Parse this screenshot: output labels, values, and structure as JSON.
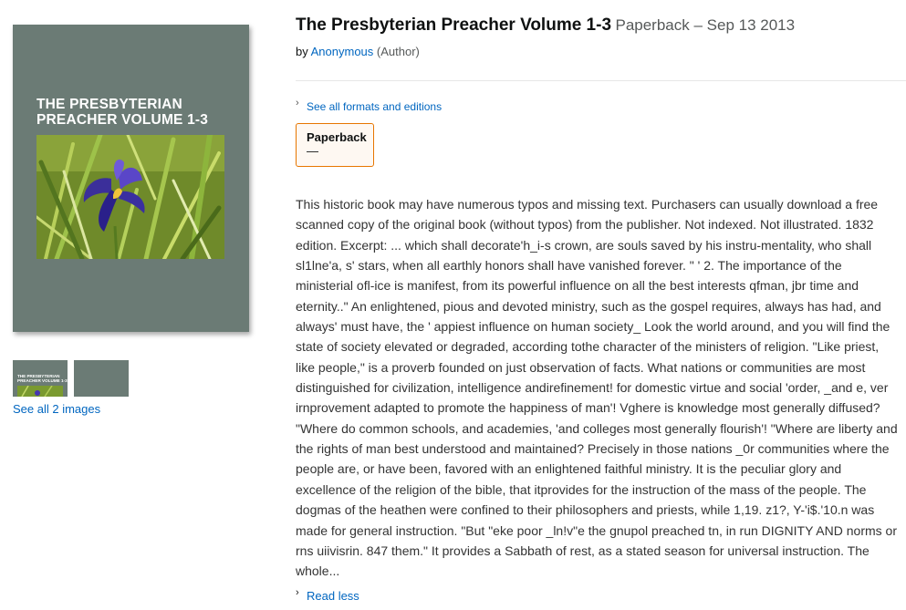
{
  "product": {
    "title": "The Presbyterian Preacher Volume 1-3",
    "format_date": "Paperback – Sep 13 2013",
    "author": "Anonymous",
    "author_role": "(Author)"
  },
  "cover": {
    "title_line1": "THE PRESBYTERIAN",
    "title_line2": "PREACHER VOLUME 1-3",
    "background_color": "#6b7b75"
  },
  "thumbnails": {
    "thumb1_title_line1": "THE PRESBYTERIAN",
    "thumb1_title_line2": "PREACHER VOLUME 1-3",
    "see_all_label": "See all 2 images"
  },
  "formats": {
    "see_all_label": "See all formats and editions",
    "selected_format": "Paperback",
    "selected_price": "—",
    "accent_color": "#e77600"
  },
  "description": {
    "text": "This historic book may have numerous typos and missing text. Purchasers can usually download a free scanned copy of the original book (without typos) from the publisher. Not indexed. Not illustrated. 1832 edition. Excerpt: ... which shall decorate'h_i-s crown, are souls saved by his instru-mentality, who shall sl1lne'a, s' stars, when all earthly honors shall have vanished forever. \" ' 2. The importance of the ministerial ofl-ice is manifest, from its powerful influence on all the best interests qfman, jbr time and eternity..\" An enlightened, pious and devoted ministry, such as the gospel requires, always has had, and always' must have, the ' appiest influence on human society_ Look the world around, and you will find the state of society elevated or degraded, according tothe character of the ministers of religion. \"Like priest, like people,\" is a proverb founded on just observation of facts. What nations or communities are most distinguished for civilization, intelligence andirefinement! for domestic virtue and social 'order, _and e, ver irnprovement adapted to promote the happiness of man'! Vghere is knowledge most generally diffused? \"Where do common schools, and academies, 'and colleges most generally flourish'! \"Where are liberty and the rights of man best understood and maintained? Precisely in those nations _0r communities where the people are, or have been, favored with an enlightened faithful ministry. It is the peculiar glory and excellence of the religion of the bible, that itprovides for the instruction of the mass of the people. The dogmas of the heathen were confined to their philosophers and priests, while 1,19. z1?, Y-'i$.'10.n was made for general instruction. \"But \"eke poor _ln!v\"e the gnupol preached tn, in run DIGNITY AND norms or rns uiivisrin. 847 them.\" It provides a Sabbath of rest, as a stated season for universal instruction. The whole...",
    "read_less_label": "Read less"
  },
  "icons": {
    "chevron": "chevron-right-icon"
  },
  "colors": {
    "link": "#0066c0",
    "text": "#333333"
  }
}
